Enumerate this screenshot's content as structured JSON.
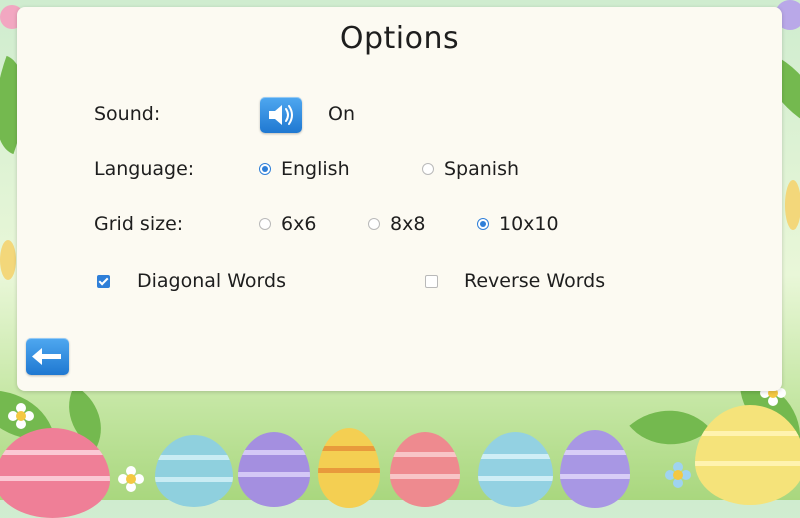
{
  "screen": {
    "title": "Options"
  },
  "sound": {
    "label": "Sound:",
    "value": "On",
    "icon": "speaker-icon"
  },
  "language": {
    "label": "Language:",
    "options": [
      {
        "label": "English",
        "selected": true
      },
      {
        "label": "Spanish",
        "selected": false
      }
    ]
  },
  "grid_size": {
    "label": "Grid size:",
    "options": [
      {
        "label": "6x6",
        "selected": false
      },
      {
        "label": "8x8",
        "selected": false
      },
      {
        "label": "10x10",
        "selected": true
      }
    ]
  },
  "words": {
    "diagonal": {
      "label": "Diagonal Words",
      "checked": true
    },
    "reverse": {
      "label": "Reverse Words",
      "checked": false
    }
  },
  "back": {
    "icon": "back-arrow-icon"
  },
  "colors": {
    "accent": "#2f7fd8",
    "panel": "#fcfaf2",
    "button": "#1f78d1"
  }
}
